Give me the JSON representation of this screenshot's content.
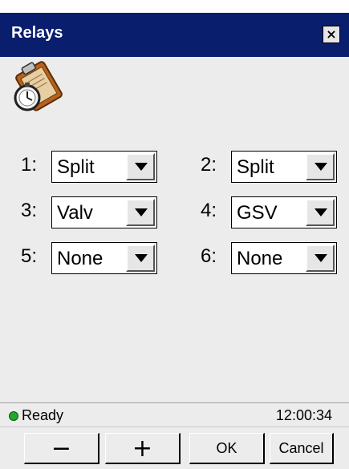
{
  "window": {
    "title": "Relays",
    "close_label": "×"
  },
  "relays": [
    {
      "label": "1:",
      "value": "Split"
    },
    {
      "label": "2:",
      "value": "Split"
    },
    {
      "label": "3:",
      "value": "Valv"
    },
    {
      "label": "4:",
      "value": "GSV"
    },
    {
      "label": "5:",
      "value": "None"
    },
    {
      "label": "6:",
      "value": "None"
    }
  ],
  "status": {
    "text": "Ready",
    "time": "12:00:34",
    "indicator_color": "#22a82a"
  },
  "buttons": {
    "minus": "−",
    "plus": "+",
    "ok": "OK",
    "cancel": "Cancel"
  },
  "colors": {
    "titlebar": "#0a1e6e",
    "background": "#ececec"
  },
  "icons": {
    "app": "clipboard-stopwatch-icon",
    "dropdown": "chevron-down-icon",
    "status": "status-dot-icon"
  }
}
